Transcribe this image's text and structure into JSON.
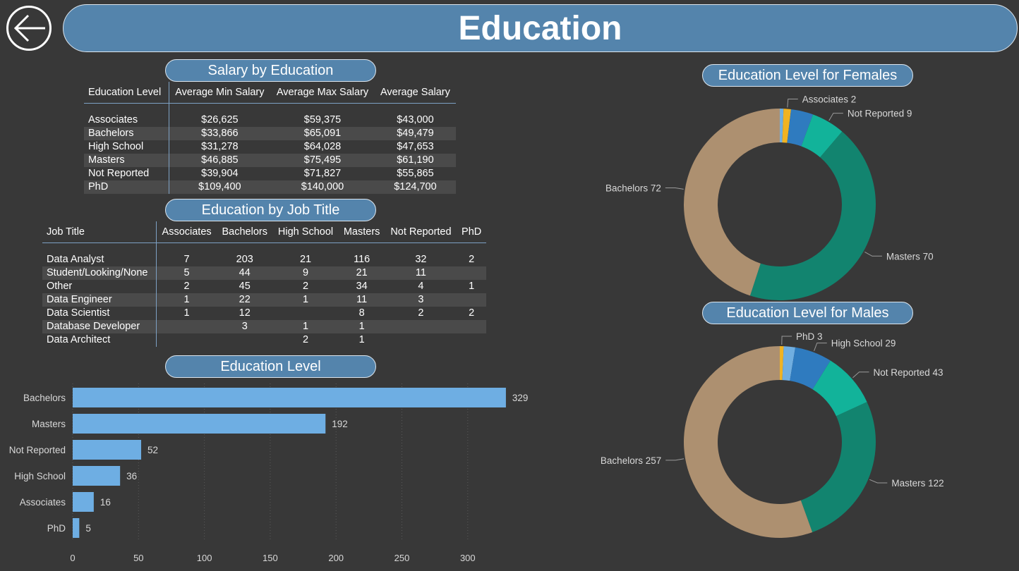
{
  "header": {
    "title": "Education",
    "back_icon": "arrow-left-icon"
  },
  "salary_table": {
    "title": "Salary by Education",
    "columns": [
      "Education Level",
      "Average Min Salary",
      "Average Max Salary",
      "Average Salary"
    ],
    "rows": [
      [
        "Associates",
        "$26,625",
        "$59,375",
        "$43,000"
      ],
      [
        "Bachelors",
        "$33,866",
        "$65,091",
        "$49,479"
      ],
      [
        "High School",
        "$31,278",
        "$64,028",
        "$47,653"
      ],
      [
        "Masters",
        "$46,885",
        "$75,495",
        "$61,190"
      ],
      [
        "Not Reported",
        "$39,904",
        "$71,827",
        "$55,865"
      ],
      [
        "PhD",
        "$109,400",
        "$140,000",
        "$124,700"
      ]
    ]
  },
  "job_table": {
    "title": "Education by Job Title",
    "columns": [
      "Job Title",
      "Associates",
      "Bachelors",
      "High School",
      "Masters",
      "Not Reported",
      "PhD"
    ],
    "rows": [
      [
        "Data Analyst",
        "7",
        "203",
        "21",
        "116",
        "32",
        "2"
      ],
      [
        "Student/Looking/None",
        "5",
        "44",
        "9",
        "21",
        "11",
        ""
      ],
      [
        "Other",
        "2",
        "45",
        "2",
        "34",
        "4",
        "1"
      ],
      [
        "Data Engineer",
        "1",
        "22",
        "1",
        "11",
        "3",
        ""
      ],
      [
        "Data Scientist",
        "1",
        "12",
        "",
        "8",
        "2",
        "2"
      ],
      [
        "Database Developer",
        "",
        "3",
        "1",
        "1",
        "",
        ""
      ],
      [
        "Data Architect",
        "",
        "",
        "2",
        "1",
        "",
        ""
      ]
    ]
  },
  "chart_data": [
    {
      "type": "bar",
      "orientation": "horizontal",
      "title": "Education Level",
      "categories": [
        "Bachelors",
        "Masters",
        "Not Reported",
        "High School",
        "Associates",
        "PhD"
      ],
      "values": [
        329,
        192,
        52,
        36,
        16,
        5
      ],
      "xlim": [
        0,
        330
      ],
      "xticks": [
        0,
        50,
        100,
        150,
        200,
        250,
        300
      ],
      "grid": true,
      "color": "#6eaee3"
    },
    {
      "type": "pie",
      "donut": true,
      "title": "Education Level for Females",
      "categories": [
        "PhD",
        "Associates",
        "High School",
        "Not Reported",
        "Masters",
        "Bachelors"
      ],
      "values": [
        1,
        2,
        6,
        9,
        70,
        72
      ],
      "labels": [
        {
          "category": "Associates",
          "text": "Associates 2"
        },
        {
          "category": "Not Reported",
          "text": "Not Reported 9"
        },
        {
          "category": "Masters",
          "text": "Masters 70"
        },
        {
          "category": "Bachelors",
          "text": "Bachelors 72"
        }
      ],
      "colors": [
        "#70aee0",
        "#f0b323",
        "#2f7bbf",
        "#12b39a",
        "#12846f",
        "#ad9070"
      ]
    },
    {
      "type": "pie",
      "donut": true,
      "title": "Education Level for Males",
      "categories": [
        "PhD",
        "Associates",
        "High School",
        "Not Reported",
        "Masters",
        "Bachelors"
      ],
      "values": [
        3,
        9,
        29,
        43,
        122,
        257
      ],
      "labels": [
        {
          "category": "PhD",
          "text": "PhD 3"
        },
        {
          "category": "High School",
          "text": "High School 29"
        },
        {
          "category": "Not Reported",
          "text": "Not Reported 43"
        },
        {
          "category": "Masters",
          "text": "Masters 122"
        },
        {
          "category": "Bachelors",
          "text": "Bachelors 257"
        }
      ],
      "colors": [
        "#f0b323",
        "#70aee0",
        "#2f7bbf",
        "#12b39a",
        "#12846f",
        "#ad9070"
      ]
    }
  ]
}
